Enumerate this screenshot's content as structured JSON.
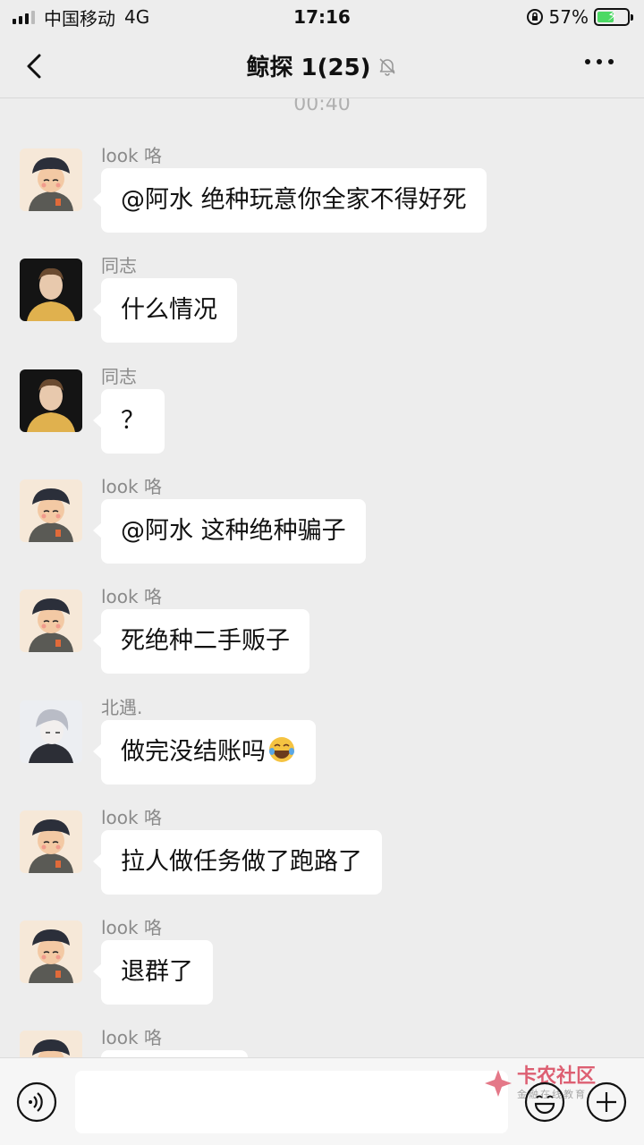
{
  "status_bar": {
    "carrier": "中国移动",
    "network": "4G",
    "time": "17:16",
    "battery_percent": "57%",
    "battery_level": 0.57
  },
  "nav": {
    "title": "鲸探 1(25)",
    "muted": true
  },
  "chat": {
    "timestamp": "00:40",
    "messages": [
      {
        "sender": "look 咯",
        "text": "@阿水 绝种玩意你全家不得好死",
        "avatar": "cartoon-boy"
      },
      {
        "sender": "同志",
        "text": "什么情况",
        "avatar": "portrait-man"
      },
      {
        "sender": "同志",
        "text": "？",
        "avatar": "portrait-man"
      },
      {
        "sender": "look 咯",
        "text": "@阿水 这种绝种骗子",
        "avatar": "cartoon-boy"
      },
      {
        "sender": "look 咯",
        "text": "死绝种二手贩子",
        "avatar": "cartoon-boy"
      },
      {
        "sender": "北遇.",
        "text": "做完没结账吗",
        "emoji": "laughing-crying-emoji",
        "avatar": "anime-boy"
      },
      {
        "sender": "look 咯",
        "text": "拉人做任务做了跑路了",
        "avatar": "cartoon-boy"
      },
      {
        "sender": "look 咯",
        "text": "退群了",
        "avatar": "cartoon-boy"
      },
      {
        "sender": "look 咯",
        "text": "",
        "avatar": "cartoon-boy"
      }
    ]
  },
  "input_bar": {
    "value": "",
    "watermark_main": "卡农社区",
    "watermark_sub": "金融在线教育"
  },
  "colors": {
    "background": "#ededed",
    "bubble": "#ffffff",
    "sender": "#8a8a8a",
    "watermark": "#d9455b"
  }
}
